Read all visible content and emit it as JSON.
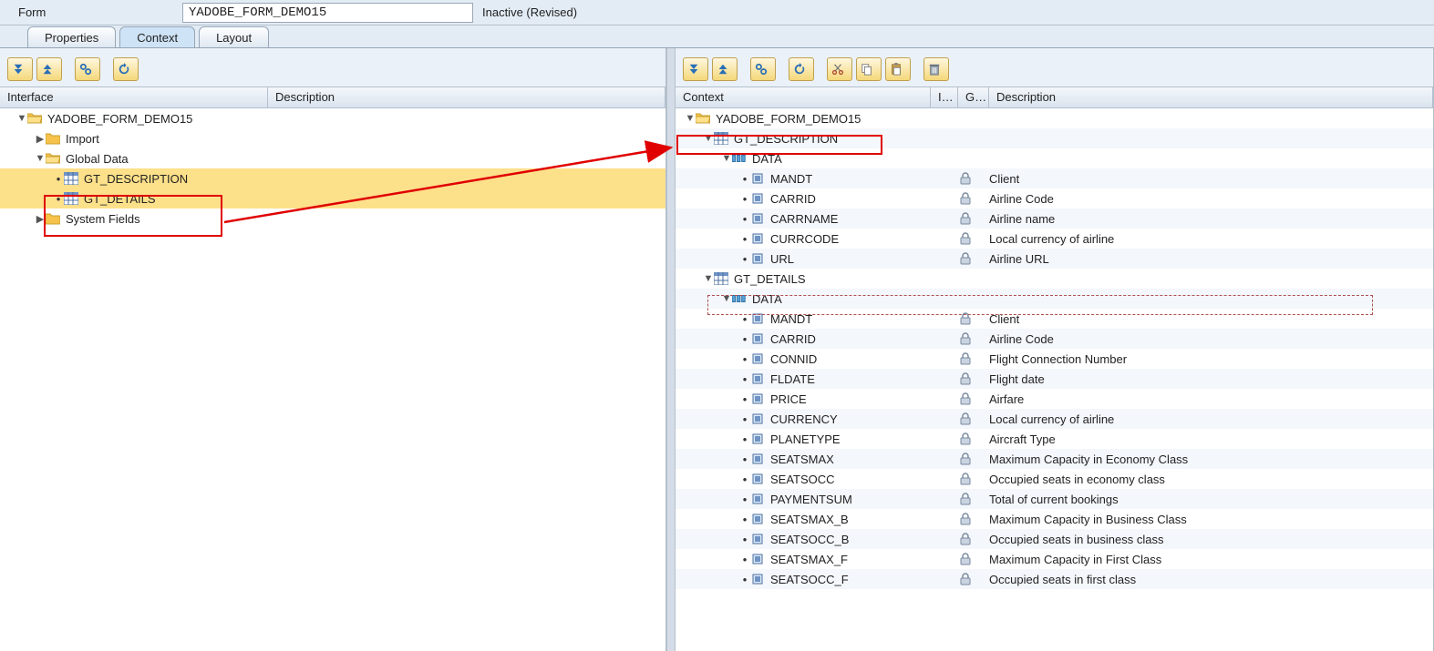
{
  "header": {
    "label": "Form",
    "formName": "YADOBE_FORM_DEMO15",
    "status": "Inactive (Revised)"
  },
  "tabs": [
    {
      "id": "properties",
      "label": "Properties",
      "active": false
    },
    {
      "id": "context",
      "label": "Context",
      "active": true
    },
    {
      "id": "layout",
      "label": "Layout",
      "active": false
    }
  ],
  "leftPanel": {
    "columns": {
      "c1": "Interface",
      "c2": "Description"
    },
    "rootName": "YADOBE_FORM_DEMO15",
    "nodes": {
      "import": "Import",
      "global": "Global Data",
      "gt_desc": "GT_DESCRIPTION",
      "gt_det": "GT_DETAILS",
      "sysf": "System Fields"
    }
  },
  "rightPanel": {
    "columns": {
      "c1": "Context",
      "c2": "I…",
      "c3": "G…",
      "c4": "Description"
    },
    "rootName": "YADOBE_FORM_DEMO15",
    "tables": {
      "desc": {
        "name": "GT_DESCRIPTION",
        "data": "DATA"
      },
      "det": {
        "name": "GT_DETAILS",
        "data": "DATA"
      }
    },
    "descFields": [
      {
        "name": "MANDT",
        "desc": "Client"
      },
      {
        "name": "CARRID",
        "desc": "Airline Code"
      },
      {
        "name": "CARRNAME",
        "desc": "Airline name"
      },
      {
        "name": "CURRCODE",
        "desc": "Local currency of airline"
      },
      {
        "name": "URL",
        "desc": "Airline URL"
      }
    ],
    "detFields": [
      {
        "name": "MANDT",
        "desc": "Client"
      },
      {
        "name": "CARRID",
        "desc": "Airline Code"
      },
      {
        "name": "CONNID",
        "desc": "Flight Connection Number"
      },
      {
        "name": "FLDATE",
        "desc": "Flight date"
      },
      {
        "name": "PRICE",
        "desc": "Airfare"
      },
      {
        "name": "CURRENCY",
        "desc": "Local currency of airline"
      },
      {
        "name": "PLANETYPE",
        "desc": "Aircraft Type"
      },
      {
        "name": "SEATSMAX",
        "desc": "Maximum Capacity in Economy Class"
      },
      {
        "name": "SEATSOCC",
        "desc": "Occupied seats in economy class"
      },
      {
        "name": "PAYMENTSUM",
        "desc": "Total of current bookings"
      },
      {
        "name": "SEATSMAX_B",
        "desc": "Maximum Capacity in Business Class"
      },
      {
        "name": "SEATSOCC_B",
        "desc": "Occupied seats in business class"
      },
      {
        "name": "SEATSMAX_F",
        "desc": "Maximum Capacity in First Class"
      },
      {
        "name": "SEATSOCC_F",
        "desc": "Occupied seats in first class"
      }
    ]
  },
  "iconNames": {
    "expandAll": "expand-all-icon",
    "collapseAll": "collapse-all-icon",
    "find": "find-icon",
    "refresh": "refresh-icon",
    "cut": "cut-icon",
    "copy": "copy-icon",
    "paste": "paste-icon",
    "delete": "delete-icon"
  }
}
